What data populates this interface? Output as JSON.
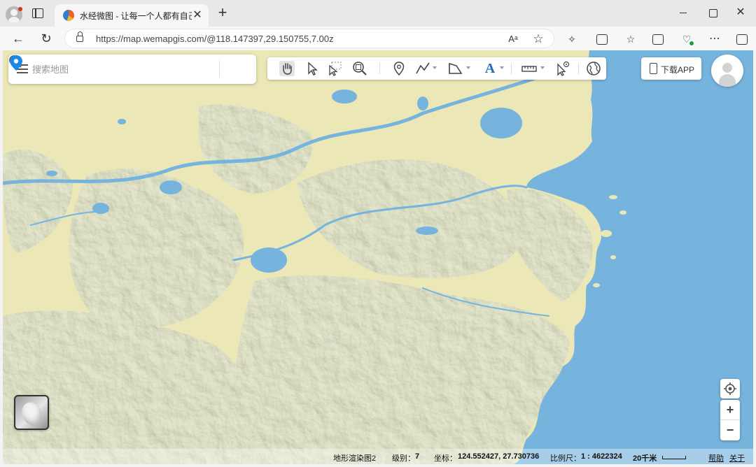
{
  "browser": {
    "tab_title": "水经微图 - 让每一个人都有自己的",
    "tab_close": "✕",
    "new_tab": "+",
    "url": "https://map.wemapgis.com/@118.147397,29.150755,7.00z",
    "read_aloud": "Aᵃ",
    "back": "←",
    "reload": "↻",
    "favorite": "☆",
    "window_close": "✕"
  },
  "search": {
    "placeholder": "搜索地图"
  },
  "toolbar": {
    "tools": [
      "pan-hand-icon",
      "select-arrow-icon",
      "box-select-icon",
      "zoom-box-icon",
      "marker-pin-icon",
      "polyline-icon",
      "polygon-icon",
      "text-icon",
      "measure-ruler-icon",
      "identify-icon",
      "globe-icon"
    ],
    "text_tool": "A"
  },
  "download_app": {
    "label": "下载APP"
  },
  "map_controls": {
    "zoom_in": "+",
    "zoom_out": "−"
  },
  "colors": {
    "land": "#ece7b6",
    "water": "#77b4dd",
    "relief_dark": "#96a382",
    "relief_mid": "#b4bd94",
    "accent_blue": "#1e88e5"
  },
  "status": {
    "layer": "地形渲染图2",
    "level_label": "级别：",
    "level": "7",
    "coord_label": "坐标：",
    "coord": "124.552427, 27.730736",
    "scale_label": "比例尺：",
    "scale": "1 : 4622324",
    "distance": "20千米",
    "help": "帮助",
    "about": "关于"
  }
}
